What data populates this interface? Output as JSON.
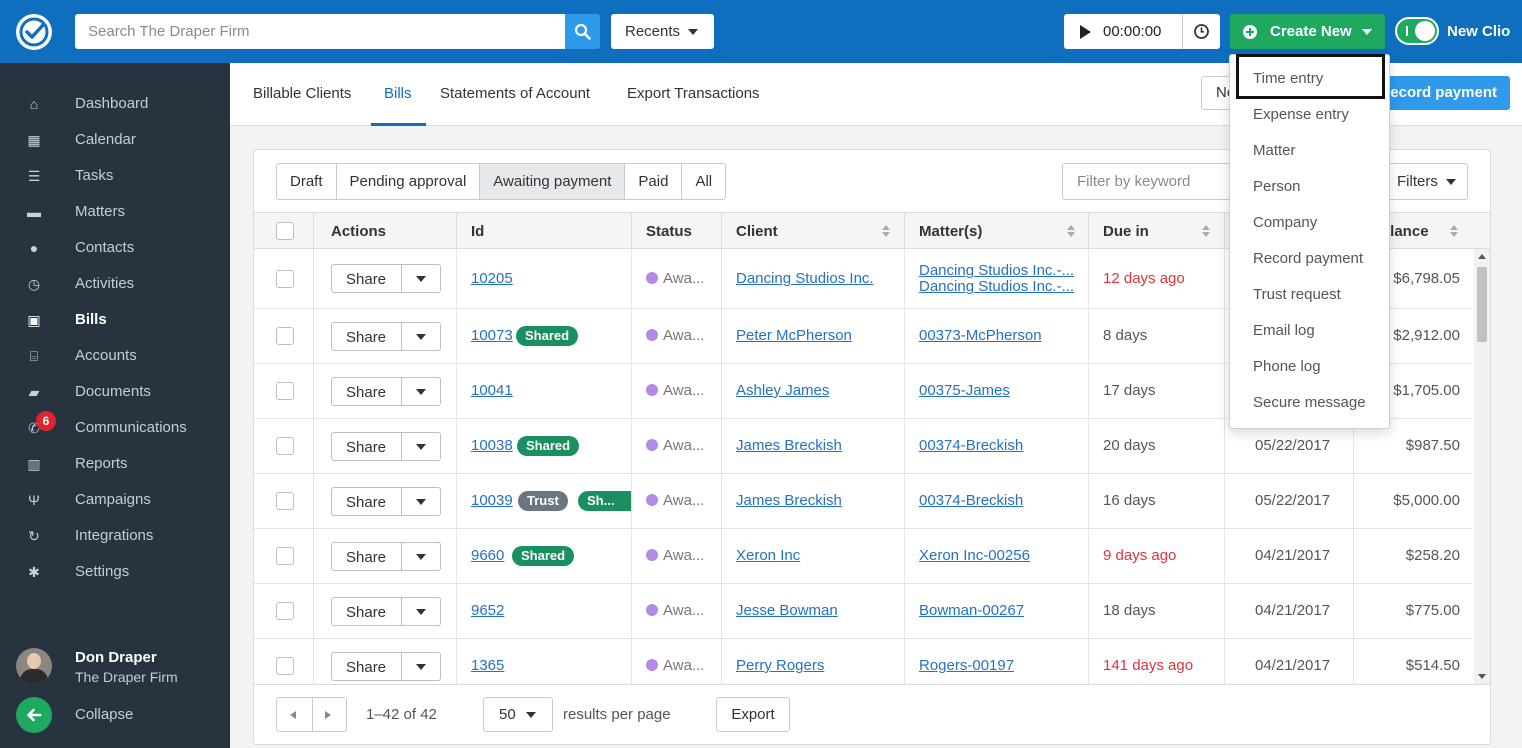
{
  "topbar": {
    "search_placeholder": "Search The Draper Firm",
    "recents_label": "Recents",
    "timer_value": "00:00:00",
    "create_label": "Create New",
    "new_clio_label": "New Clio"
  },
  "sidebar": {
    "items": [
      {
        "label": "Dashboard",
        "icon": "home-icon"
      },
      {
        "label": "Calendar",
        "icon": "calendar-icon"
      },
      {
        "label": "Tasks",
        "icon": "list-icon"
      },
      {
        "label": "Matters",
        "icon": "briefcase-icon"
      },
      {
        "label": "Contacts",
        "icon": "person-icon"
      },
      {
        "label": "Activities",
        "icon": "clock-icon"
      },
      {
        "label": "Bills",
        "icon": "money-icon"
      },
      {
        "label": "Accounts",
        "icon": "bank-icon"
      },
      {
        "label": "Documents",
        "icon": "folder-icon"
      },
      {
        "label": "Communications",
        "icon": "phone-icon"
      },
      {
        "label": "Reports",
        "icon": "bar-chart-icon"
      },
      {
        "label": "Campaigns",
        "icon": "trophy-icon"
      },
      {
        "label": "Integrations",
        "icon": "refresh-icon"
      },
      {
        "label": "Settings",
        "icon": "gear-icon"
      }
    ],
    "communications_badge": "6",
    "user_name": "Don Draper",
    "user_firm": "The Draper Firm",
    "collapse_label": "Collapse"
  },
  "subnav": {
    "tabs": [
      "Billable Clients",
      "Bills",
      "Statements of Account",
      "Export Transactions"
    ],
    "new_label": "New",
    "record_payment_label": "Record payment"
  },
  "filters": {
    "tabs": [
      "Draft",
      "Pending approval",
      "Awaiting payment",
      "Paid",
      "All"
    ],
    "keyword_placeholder": "Filter by keyword",
    "filters_label": "Filters"
  },
  "table": {
    "headers": {
      "actions": "Actions",
      "id": "Id",
      "status": "Status",
      "client": "Client",
      "matters": "Matter(s)",
      "due": "Due in",
      "balance": "Balance"
    },
    "share_label": "Share",
    "rows": [
      {
        "id": "10205",
        "tags": [],
        "status": "Awa...",
        "client": "Dancing Studios Inc.",
        "matter": "Dancing Studios Inc.-...",
        "matter2": "Dancing Studios Inc.-...",
        "due": "12 days ago",
        "overdue": true,
        "date": "",
        "balance": "$6,798.05"
      },
      {
        "id": "10073",
        "tags": [
          "Shared"
        ],
        "status": "Awa...",
        "client": "Peter McPherson",
        "matter": "00373-McPherson",
        "due": "8 days",
        "overdue": false,
        "date": "",
        "balance": "$2,912.00"
      },
      {
        "id": "10041",
        "tags": [],
        "status": "Awa...",
        "client": "Ashley James",
        "matter": "00375-James",
        "due": "17 days",
        "overdue": false,
        "date": "",
        "balance": "$1,705.00"
      },
      {
        "id": "10038",
        "tags": [
          "Shared"
        ],
        "status": "Awa...",
        "client": "James Breckish",
        "matter": "00374-Breckish",
        "due": "20 days",
        "overdue": false,
        "date": "05/22/2017",
        "balance": "$987.50"
      },
      {
        "id": "10039",
        "tags": [
          "Trust",
          "Sh..."
        ],
        "status": "Awa...",
        "client": "James Breckish",
        "matter": "00374-Breckish",
        "due": "16 days",
        "overdue": false,
        "date": "05/22/2017",
        "balance": "$5,000.00"
      },
      {
        "id": "9660",
        "tags": [
          "Shared"
        ],
        "status": "Awa...",
        "client": "Xeron Inc",
        "matter": "Xeron Inc-00256",
        "due": "9 days ago",
        "overdue": true,
        "date": "04/21/2017",
        "balance": "$258.20"
      },
      {
        "id": "9652",
        "tags": [],
        "status": "Awa...",
        "client": "Jesse Bowman",
        "matter": "Bowman-00267",
        "due": "18 days",
        "overdue": false,
        "date": "04/21/2017",
        "balance": "$775.00"
      },
      {
        "id": "1365",
        "tags": [],
        "status": "Awa...",
        "client": "Perry Rogers",
        "matter": "Rogers-00197",
        "due": "141 days ago",
        "overdue": true,
        "date": "04/21/2017",
        "balance": "$514.50"
      }
    ]
  },
  "footer": {
    "count": "1–42 of 42",
    "per_page": "50",
    "results_label": "results per page",
    "export_label": "Export"
  },
  "dropdown": {
    "items": [
      "Time entry",
      "Expense entry",
      "Matter",
      "Person",
      "Company",
      "Record payment",
      "Trust request",
      "Email log",
      "Phone log",
      "Secure message"
    ]
  },
  "colors": {
    "brand_blue": "#0f6fbe",
    "create_green": "#1fa960",
    "sidebar_bg": "#27333f",
    "overdue_red": "#e0323b"
  }
}
